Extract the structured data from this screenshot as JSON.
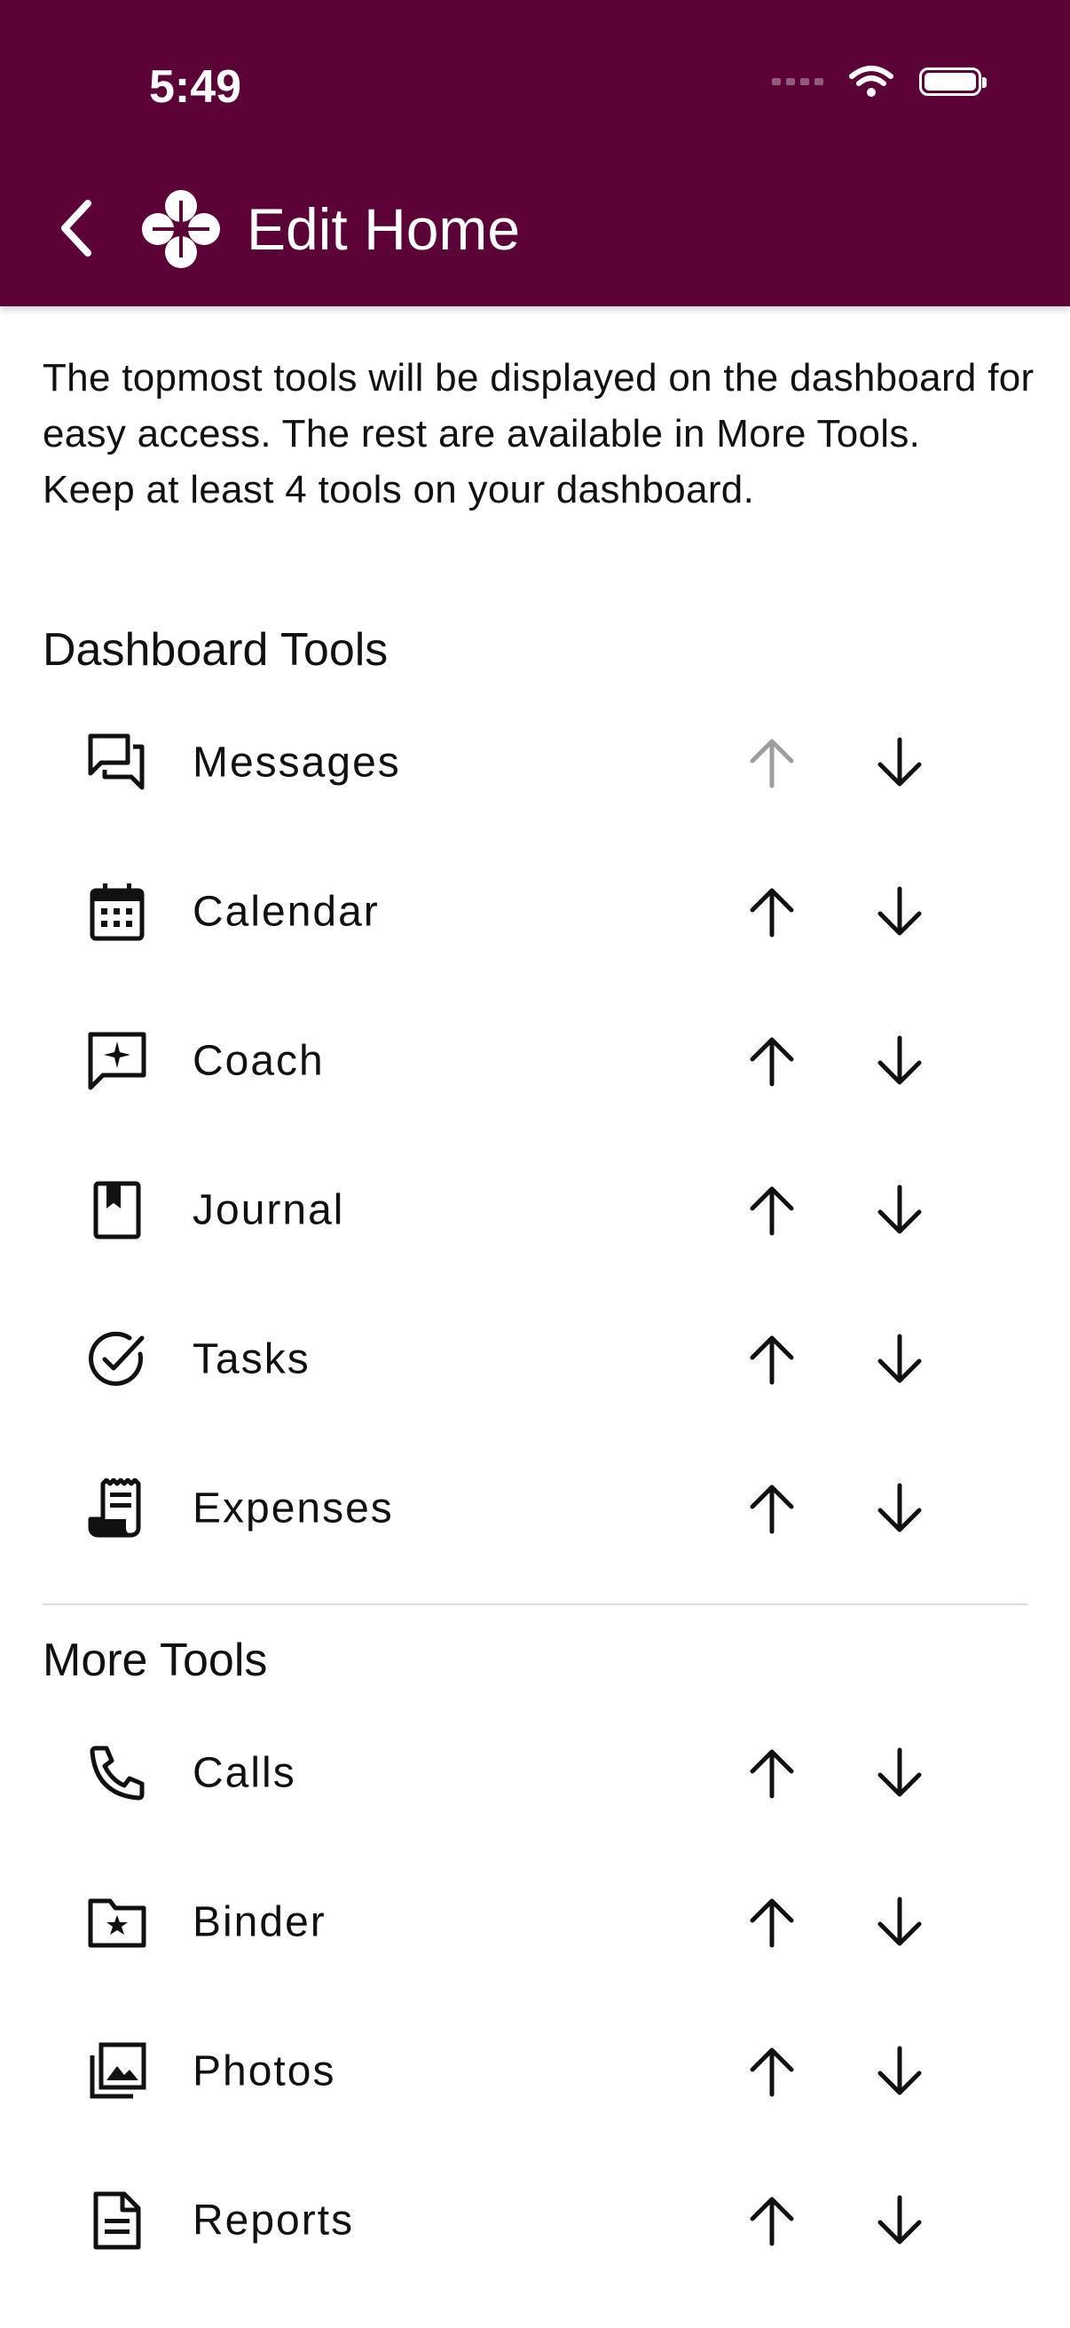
{
  "status_bar": {
    "time": "5:49"
  },
  "header": {
    "title": "Edit Home"
  },
  "intro": {
    "line1": "The topmost tools will be displayed on the dashboard for easy access. The rest are available in More Tools.",
    "line2": "Keep at least 4 tools on your dashboard."
  },
  "dashboard": {
    "title": "Dashboard Tools",
    "items": [
      {
        "label": "Messages",
        "icon": "messages-icon"
      },
      {
        "label": "Calendar",
        "icon": "calendar-icon"
      },
      {
        "label": "Coach",
        "icon": "coach-icon"
      },
      {
        "label": "Journal",
        "icon": "journal-icon"
      },
      {
        "label": "Tasks",
        "icon": "tasks-icon"
      },
      {
        "label": "Expenses",
        "icon": "expenses-icon"
      }
    ]
  },
  "more": {
    "title": "More Tools",
    "items": [
      {
        "label": "Calls",
        "icon": "phone-icon"
      },
      {
        "label": "Binder",
        "icon": "binder-icon"
      },
      {
        "label": "Photos",
        "icon": "photos-icon"
      },
      {
        "label": "Reports",
        "icon": "reports-icon"
      }
    ]
  },
  "colors": {
    "header_bg": "#5b0337",
    "text": "#111111",
    "disabled_arrow": "#9e9e9e"
  }
}
